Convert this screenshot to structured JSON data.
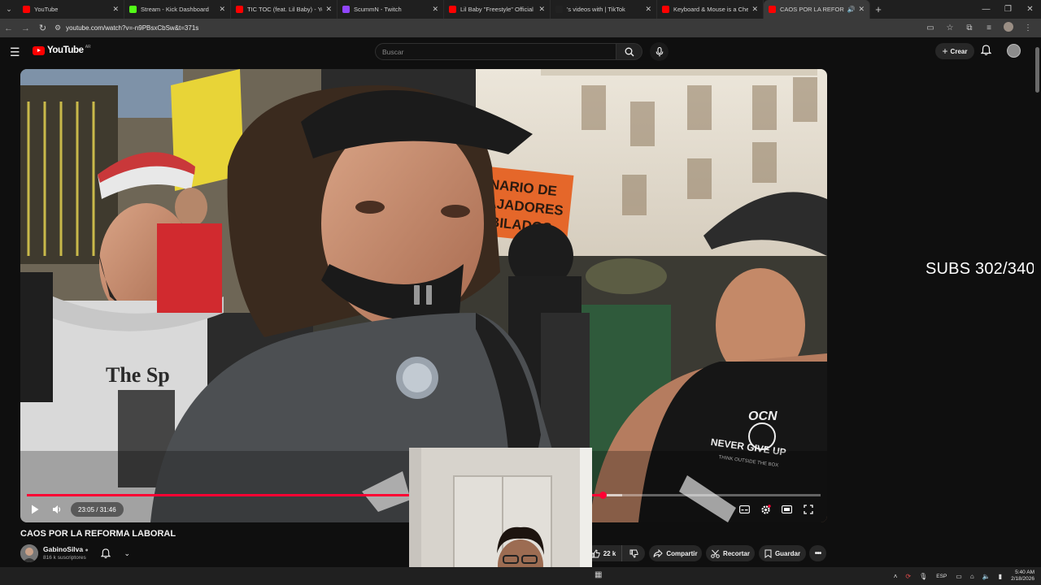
{
  "browser": {
    "tabs": [
      {
        "title": "YouTube",
        "favicon_color": "#ff0000",
        "active": false
      },
      {
        "title": "Stream - Kick Dashboard",
        "favicon_color": "#53fc18",
        "active": false
      },
      {
        "title": "TIC TOC (feat. Lil Baby) - YouTube",
        "favicon_color": "#ff0000",
        "active": false
      },
      {
        "title": "ScummN - Twitch",
        "favicon_color": "#9146ff",
        "active": false
      },
      {
        "title": "Lil Baby \"Freestyle\" Official Music",
        "favicon_color": "#ff0000",
        "active": false
      },
      {
        "title": "'s videos with | TikTok",
        "favicon_color": "#222222",
        "active": false
      },
      {
        "title": "Keyboard & Mouse is a Cheat Code",
        "favicon_color": "#ff0000",
        "active": false
      },
      {
        "title": "CAOS POR LA REFORMA LABORAL",
        "favicon_color": "#ff0000",
        "active": true
      }
    ],
    "url": "youtube.com/watch?v=-n9PBsxCbSw&t=371s"
  },
  "masthead": {
    "logo_text": "YouTube",
    "country_code": "AR",
    "search_placeholder": "Buscar",
    "create_label": "Crear"
  },
  "player": {
    "current_time": "23:05",
    "duration": "31:46",
    "time_display": "23:05 / 31:46",
    "progress_fraction": 0.726,
    "buffered_fraction": 0.75,
    "state": "paused",
    "accent_color": "#ff0033"
  },
  "overlay": {
    "subs_counter": "SUBS 302/340"
  },
  "video": {
    "title": "CAOS POR LA REFORMA LABORAL",
    "channel_name": "GabinoSilva",
    "subscribers": "816 k suscriptores",
    "likes": "22 k",
    "share_label": "Compartir",
    "clip_label": "Recortar",
    "save_label": "Guardar"
  },
  "scene_text": {
    "banner_orange": "CENTENARIO DE\nTRABAJADORES\nJUBILADOS",
    "shirt_left": "The Sp",
    "shirt_right_top": "OCN",
    "shirt_right_mid": "NEVER GIVE UP",
    "shirt_right_small": "THINK OUTSIDE THE BOX"
  },
  "taskbar": {
    "language": "ESP",
    "time": "5:40 AM",
    "date": "2/18/2026"
  }
}
